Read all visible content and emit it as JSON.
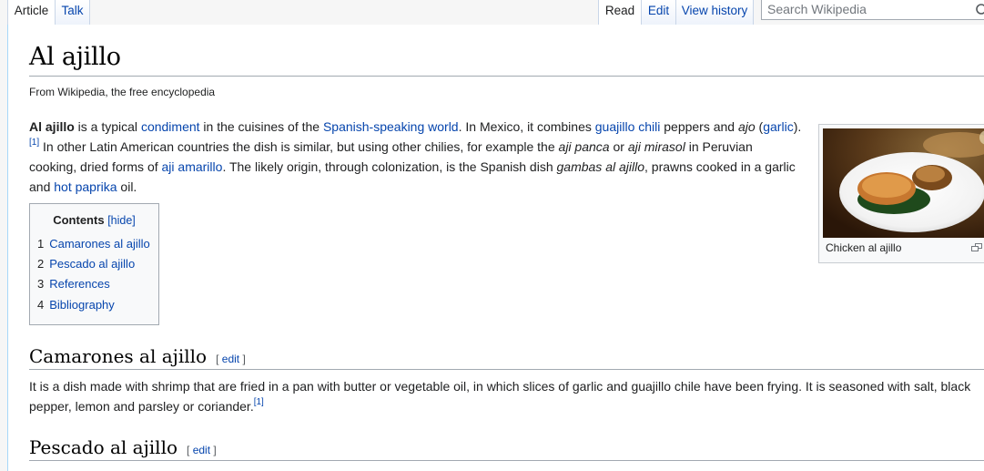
{
  "tabs": {
    "article": "Article",
    "talk": "Talk",
    "read": "Read",
    "edit": "Edit",
    "view_history": "View history"
  },
  "search": {
    "placeholder": "Search Wikipedia",
    "icon": "search-icon"
  },
  "article": {
    "title": "Al ajillo",
    "tagline": "From Wikipedia, the free encyclopedia"
  },
  "lead": {
    "term": "Al ajillo",
    "t1": " is a typical ",
    "l_condiment": "condiment",
    "t2": " in the cuisines of the ",
    "l_spanish": "Spanish-speaking world",
    "t3": ". In Mexico, it combines ",
    "l_guajillo": "guajillo chili",
    "t4": " peppers and ",
    "ajo": "ajo",
    "t5": " (",
    "l_garlic": "garlic",
    "t6": ").",
    "ref1": "[1]",
    "t7": " In other Latin American countries the dish is similar, but using other chilies, for example the ",
    "aji_panca": "aji panca",
    "t8": " or ",
    "aji_mirasol": "aji mirasol",
    "t9": " in Peruvian cooking, dried forms of ",
    "l_aji_amarillo": "aji amarillo",
    "t10": ". The likely origin, through colonization, is the Spanish dish ",
    "gambas": "gambas al ajillo",
    "t11": ", prawns cooked in a garlic and ",
    "l_paprika": "hot paprika",
    "t12": " oil."
  },
  "toc": {
    "title": "Contents",
    "toggle": "[hide]",
    "items": [
      {
        "num": "1",
        "label": "Camarones al ajillo"
      },
      {
        "num": "2",
        "label": "Pescado al ajillo"
      },
      {
        "num": "3",
        "label": "References"
      },
      {
        "num": "4",
        "label": "Bibliography"
      }
    ]
  },
  "thumb": {
    "caption": "Chicken al ajillo",
    "icon": "magnify-icon"
  },
  "sections": [
    {
      "heading": "Camarones al ajillo",
      "edit_open": "[ ",
      "edit_label": "edit",
      "edit_close": " ]",
      "text": "It is a dish made with shrimp that are fried in a pan with butter or vegetable oil, in which slices of garlic and guajillo chile have been frying. It is seasoned with salt, black pepper, lemon and parsley or coriander.",
      "ref": "[1]"
    },
    {
      "heading": "Pescado al ajillo",
      "edit_open": "[ ",
      "edit_label": "edit",
      "edit_close": " ]"
    }
  ],
  "colors": {
    "link": "#0645ad",
    "border": "#a2a9b1",
    "tab_border": "#a7d7f9"
  }
}
